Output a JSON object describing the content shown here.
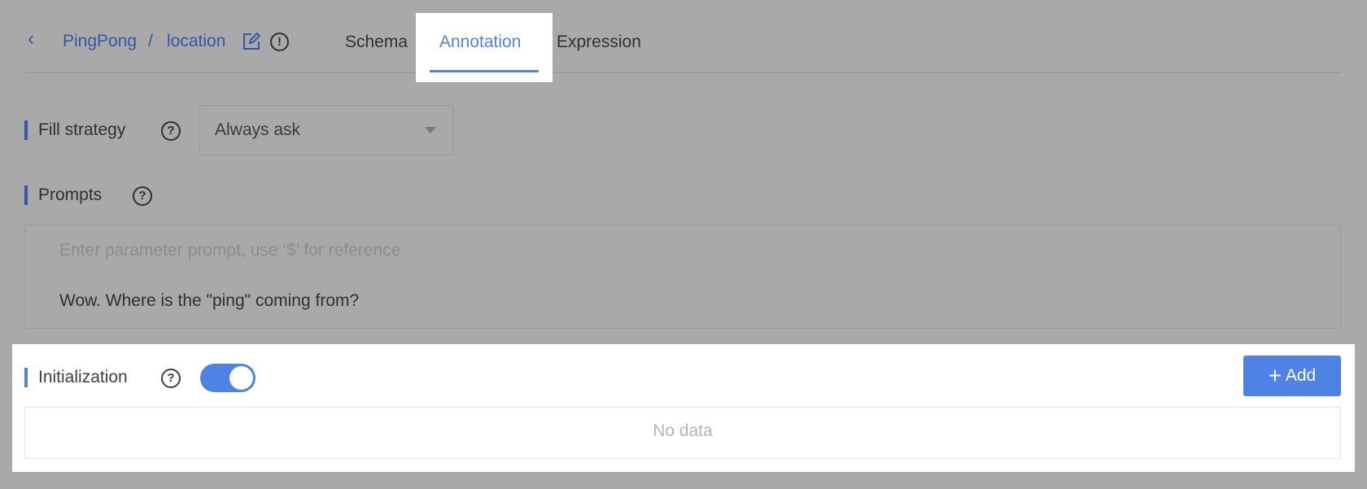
{
  "header": {
    "back_icon": "chevron-left-icon",
    "project": "PingPong",
    "separator": "/",
    "parameter": "location",
    "edit_icon": "edit-icon",
    "info_icon": "exclamation-circle-icon"
  },
  "tabs": [
    {
      "label": "Schema",
      "active": false
    },
    {
      "label": "Annotation",
      "active": true
    },
    {
      "label": "Expression",
      "active": false
    }
  ],
  "fill_strategy": {
    "label": "Fill strategy",
    "value": "Always ask"
  },
  "prompts": {
    "label": "Prompts",
    "placeholder": "Enter parameter prompt, use ‘$’ for reference",
    "value": "Wow. Where is the \"ping\" coming from?"
  },
  "initialization": {
    "label": "Initialization",
    "enabled": true,
    "add_label": "Add",
    "empty_text": "No data"
  },
  "colors": {
    "accent": "#4e82e4",
    "overlay": "#a9a9a9"
  }
}
